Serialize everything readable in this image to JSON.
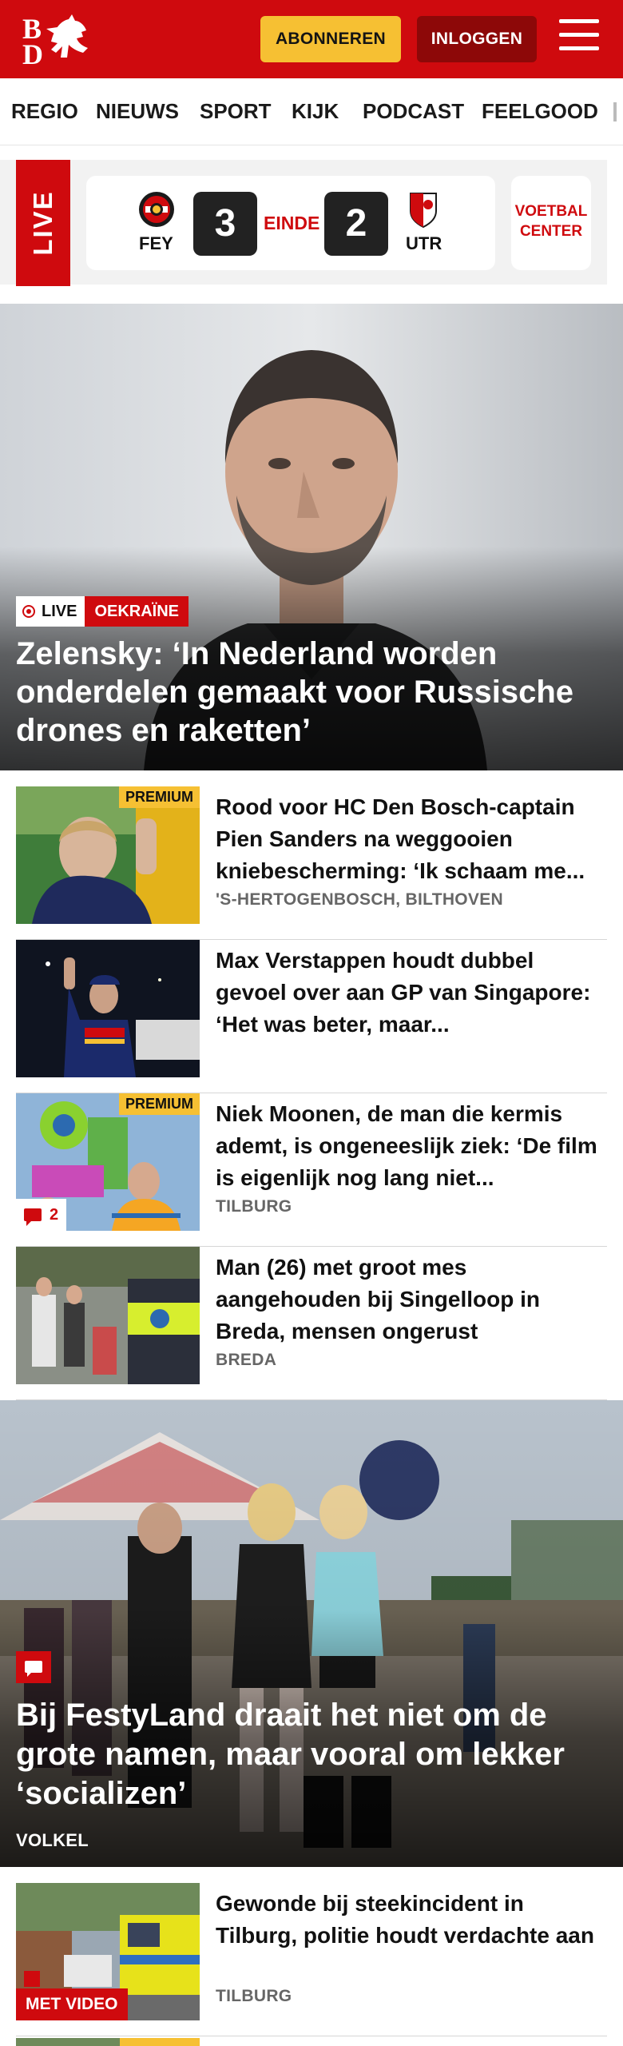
{
  "header": {
    "logo_text": "BD",
    "subscribe_label": "ABONNEREN",
    "login_label": "INLOGGEN",
    "menu_icon": "hamburger-menu-icon",
    "brand_color": "#cf0a0e"
  },
  "nav": {
    "items": [
      "REGIO",
      "NIEUWS",
      "SPORT",
      "KIJK",
      "PODCAST",
      "FEELGOOD"
    ]
  },
  "live_widget": {
    "label": "LIVE",
    "home_team": "FEY",
    "away_team": "UTR",
    "home_score": "3",
    "away_score": "2",
    "status": "EINDE",
    "voetbal_center_line1": "VOETBAL",
    "voetbal_center_line2": "CENTER"
  },
  "hero": {
    "live_tag": "LIVE",
    "category": "OEKRAÏNE",
    "title": "Zelensky: ‘In Nederland worden onderdelen gemaakt voor Russische drones en raketten’"
  },
  "articles": [
    {
      "title": "Rood voor HC Den Bosch-captain Pien Sanders na weggooien kniebescherming: ‘Ik schaam me...",
      "location": "'S-HERTOGENBOSCH, BILTHOVEN",
      "premium": "PREMIUM"
    },
    {
      "title": "Max Verstappen houdt dubbel gevoel over aan GP van Singapore: ‘Het was beter, maar...",
      "location": ""
    },
    {
      "title": "Niek Moonen, de man die kermis ademt, is ongeneeslijk ziek: ‘De film is eigenlijk nog lang niet...",
      "location": "TILBURG",
      "premium": "PREMIUM",
      "comments": "2"
    },
    {
      "title": "Man (26) met groot mes aangehouden bij Singelloop in Breda, mensen ongerust",
      "location": "BREDA"
    }
  ],
  "feature": {
    "title": "Bij FestyLand draait het niet om de grote namen, maar vooral om lekker ‘socializen’",
    "location": "VOLKEL",
    "icon": "comment-icon"
  },
  "articles_bottom": [
    {
      "title": "Gewonde bij steekincident in Tilburg, politie houdt verdachte aan",
      "location": "TILBURG",
      "video_badge": "MET VIDEO"
    }
  ]
}
